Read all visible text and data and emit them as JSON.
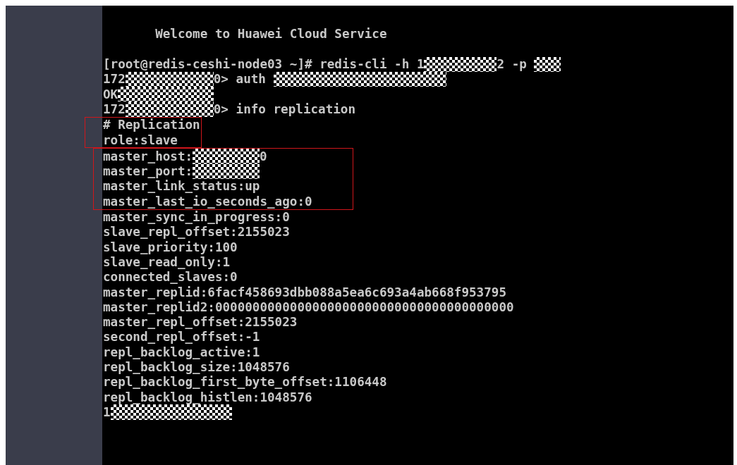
{
  "terminal": {
    "blocks": [
      {
        "highlighted": false,
        "lines": [
          [
            {
              "kind": "text",
              "text": "       Welcome to Huawei Cloud Service"
            }
          ],
          [
            {
              "kind": "gap"
            }
          ],
          [
            {
              "kind": "text",
              "text": "[root@redis-ceshi-node03 ~]# redis-cli -h 1"
            },
            {
              "kind": "redacted"
            },
            {
              "kind": "text",
              "text": "2 -p "
            },
            {
              "kind": "redacted"
            }
          ],
          [
            {
              "kind": "text",
              "text": "172"
            },
            {
              "kind": "redacted"
            },
            {
              "kind": "text",
              "text": "0> auth "
            },
            {
              "kind": "redacted"
            }
          ],
          [
            {
              "kind": "text",
              "text": "OK"
            },
            {
              "kind": "redacted"
            }
          ],
          [
            {
              "kind": "text",
              "text": "172"
            },
            {
              "kind": "redacted"
            },
            {
              "kind": "text",
              "text": "0> info replication"
            }
          ]
        ]
      },
      {
        "highlighted": true,
        "lines": [
          [
            {
              "kind": "text",
              "text": "# Replication"
            }
          ],
          [
            {
              "kind": "text",
              "text": "role:slave"
            }
          ]
        ]
      },
      {
        "highlighted": true,
        "lines": [
          [
            {
              "kind": "text",
              "text": "master_host:"
            },
            {
              "kind": "redacted"
            },
            {
              "kind": "text",
              "text": "0"
            }
          ],
          [
            {
              "kind": "text",
              "text": "master_port:"
            },
            {
              "kind": "redacted"
            }
          ],
          [
            {
              "kind": "text",
              "text": "master_link_status:up"
            }
          ],
          [
            {
              "kind": "text",
              "text": "master_last_io_seconds_ago:0"
            }
          ]
        ]
      },
      {
        "highlighted": false,
        "lines": [
          [
            {
              "kind": "text",
              "text": "master_sync_in_progress:0"
            }
          ],
          [
            {
              "kind": "text",
              "text": "slave_repl_offset:2155023"
            }
          ],
          [
            {
              "kind": "text",
              "text": "slave_priority:100"
            }
          ],
          [
            {
              "kind": "text",
              "text": "slave_read_only:1"
            }
          ],
          [
            {
              "kind": "text",
              "text": "connected_slaves:0"
            }
          ],
          [
            {
              "kind": "text",
              "text": "master_replid:6facf458693dbb088a5ea6c693a4ab668f953795"
            }
          ],
          [
            {
              "kind": "text",
              "text": "master_replid2:0000000000000000000000000000000000000000"
            }
          ],
          [
            {
              "kind": "text",
              "text": "master_repl_offset:2155023"
            }
          ],
          [
            {
              "kind": "text",
              "text": "second_repl_offset:-1"
            }
          ],
          [
            {
              "kind": "text",
              "text": "repl_backlog_active:1"
            }
          ],
          [
            {
              "kind": "text",
              "text": "repl_backlog_size:1048576"
            }
          ],
          [
            {
              "kind": "text",
              "text": "repl_backlog_first_byte_offset:1106448"
            }
          ],
          [
            {
              "kind": "text",
              "text": "repl_backlog_histlen:1048576"
            }
          ],
          [
            {
              "kind": "text",
              "text": "1"
            },
            {
              "kind": "redacted"
            }
          ]
        ]
      }
    ]
  }
}
